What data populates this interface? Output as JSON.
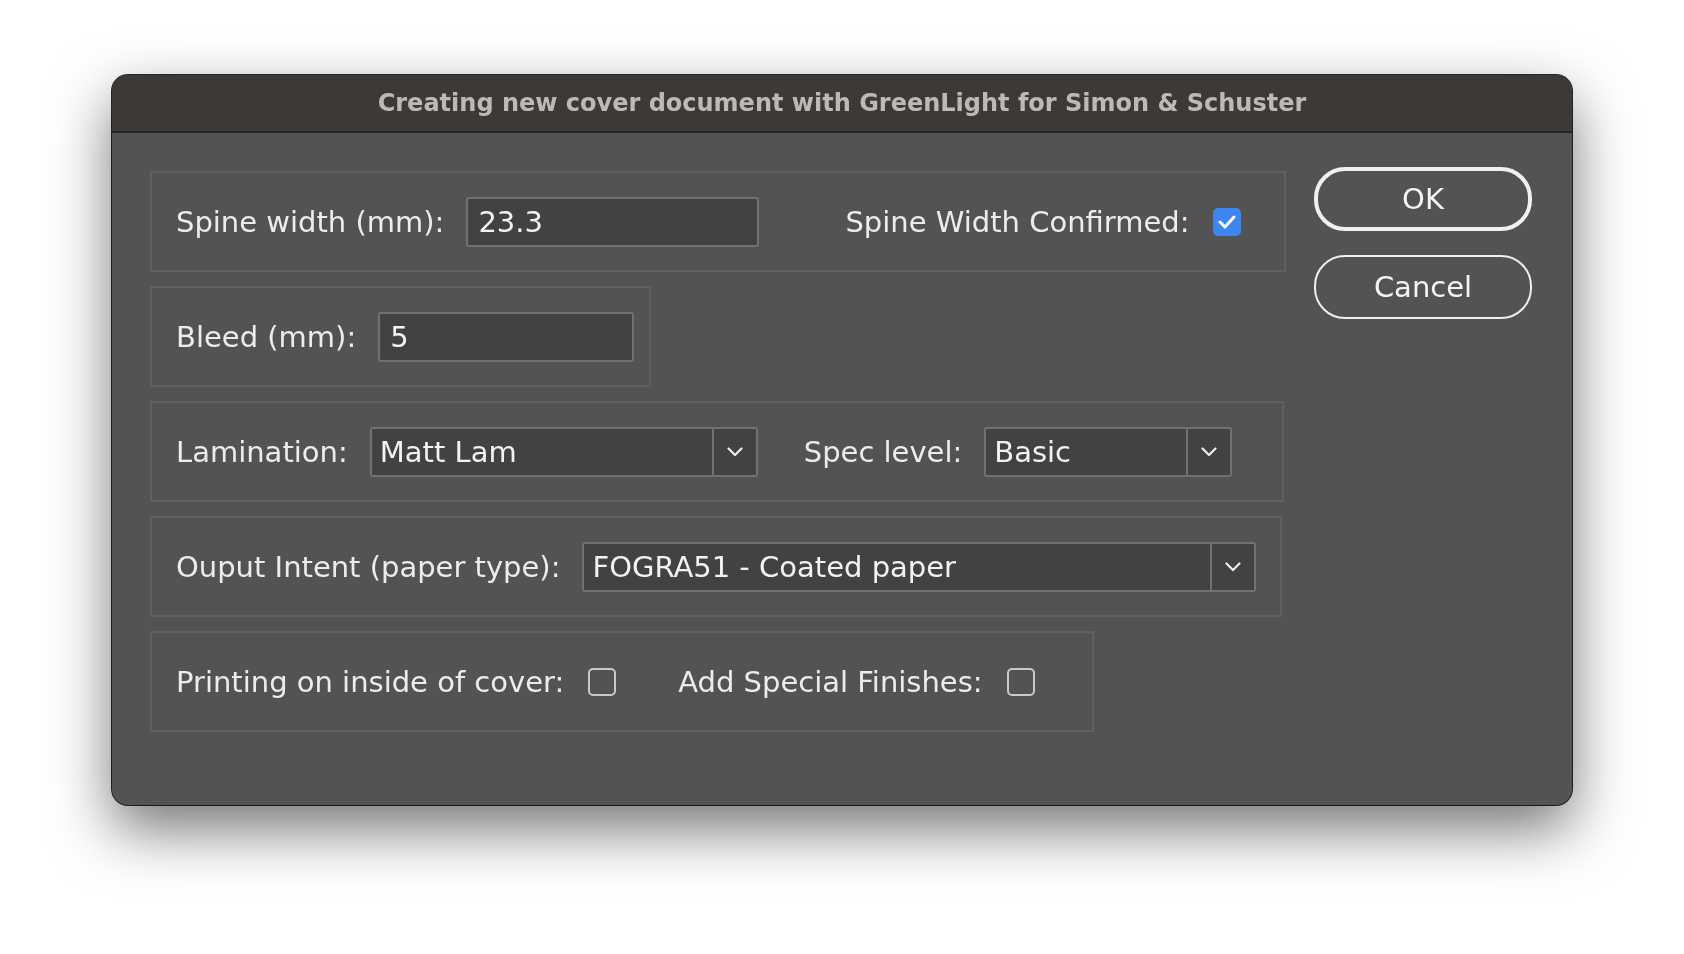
{
  "window": {
    "title": "Creating new cover document with GreenLight for Simon & Schuster"
  },
  "rows": [
    {
      "items": [
        {
          "kind": "text",
          "label": "Spine width (mm):",
          "value": "23.3"
        },
        {
          "kind": "checkbox",
          "label": "Spine Width Confirmed:",
          "checked": true
        }
      ]
    },
    {
      "items": [
        {
          "kind": "text",
          "label": "Bleed (mm):",
          "value": "5"
        }
      ]
    },
    {
      "items": [
        {
          "kind": "dropdown",
          "label": "Lamination:",
          "value": "Matt Lam"
        },
        {
          "kind": "dropdown",
          "label": "Spec level:",
          "value": "Basic"
        }
      ]
    },
    {
      "items": [
        {
          "kind": "dropdown",
          "label": "Ouput Intent (paper type):",
          "value": "FOGRA51 - Coated paper"
        }
      ]
    },
    {
      "items": [
        {
          "kind": "checkbox",
          "label": "Printing on inside of cover:",
          "checked": false
        },
        {
          "kind": "checkbox",
          "label": "Add Special Finishes:",
          "checked": false
        }
      ]
    }
  ],
  "buttons": [
    {
      "label": "OK",
      "default": true
    },
    {
      "label": "Cancel",
      "default": false
    }
  ]
}
